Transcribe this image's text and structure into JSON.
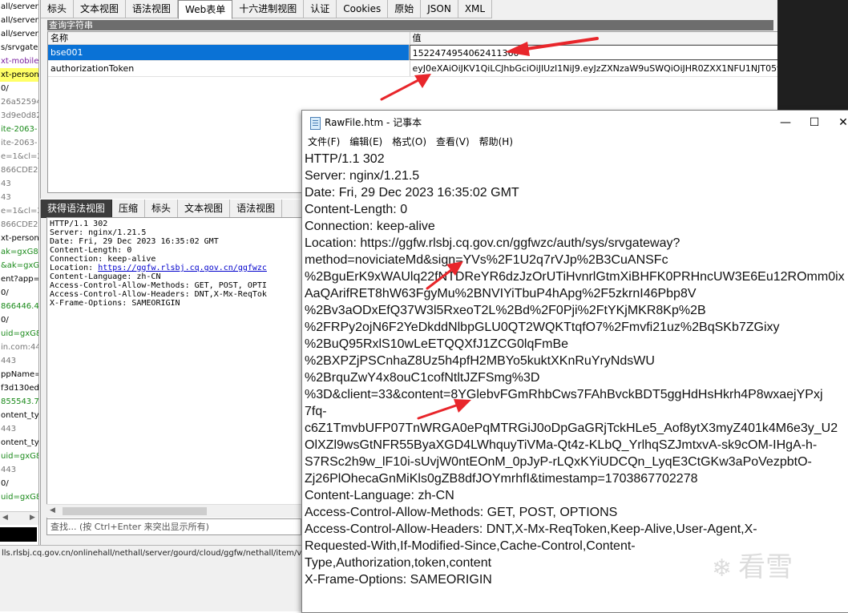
{
  "left_panel": {
    "rows": [
      {
        "text": "all/server/",
        "style": "plain"
      },
      {
        "text": "all/server/",
        "style": "plain"
      },
      {
        "text": "all/server/",
        "style": "plain"
      },
      {
        "text": "s/srvgate",
        "style": "plain"
      },
      {
        "text": "xt-mobile-",
        "style": "purple"
      },
      {
        "text": "xt-person-",
        "style": "yellow"
      },
      {
        "text": "0/",
        "style": "plain"
      },
      {
        "text": "26a52594",
        "style": "gray"
      },
      {
        "text": "3d9e0d82",
        "style": "gray"
      },
      {
        "text": "ite-2063-",
        "style": "green"
      },
      {
        "text": "ite-2063-",
        "style": "gray"
      },
      {
        "text": "e=1&cl=2",
        "style": "gray"
      },
      {
        "text": "866CDE2",
        "style": "gray"
      },
      {
        "text": "43",
        "style": "gray"
      },
      {
        "text": "43",
        "style": "gray"
      },
      {
        "text": "e=1&cl=2",
        "style": "gray"
      },
      {
        "text": "866CDE2",
        "style": "gray"
      },
      {
        "text": "xt-person-",
        "style": "plain"
      },
      {
        "text": "ak=gxG8",
        "style": "green"
      },
      {
        "text": "&ak=gxG",
        "style": "green"
      },
      {
        "text": "ent?app=",
        "style": "plain"
      },
      {
        "text": "0/",
        "style": "plain"
      },
      {
        "text": "866446.4",
        "style": "green"
      },
      {
        "text": "0/",
        "style": "plain"
      },
      {
        "text": "uid=gxG8",
        "style": "green"
      },
      {
        "text": "in.com:44",
        "style": "gray"
      },
      {
        "text": "443",
        "style": "gray"
      },
      {
        "text": "ppName=",
        "style": "plain"
      },
      {
        "text": "f3d130ed",
        "style": "plain"
      },
      {
        "text": "855543.7",
        "style": "green"
      },
      {
        "text": "ontent_typ",
        "style": "plain"
      },
      {
        "text": "443",
        "style": "gray"
      },
      {
        "text": "ontent_typ",
        "style": "plain"
      },
      {
        "text": "uid=gxG8",
        "style": "green"
      },
      {
        "text": "443",
        "style": "gray"
      },
      {
        "text": "0/",
        "style": "plain"
      },
      {
        "text": "uid=gxG8",
        "style": "green"
      }
    ]
  },
  "status_url": "lls.rlsbj.cq.gov.cn/onlinehall/nethall/server/gourd/cloud/ggfw/nethall/item/visit",
  "top_tabs": [
    "标头",
    "文本视图",
    "语法视图",
    "Web表单",
    "十六进制视图",
    "认证",
    "Cookies",
    "原始",
    "JSON",
    "XML"
  ],
  "active_top_tab": "Web表单",
  "query_section": {
    "title": "查询字符串",
    "col_name": "名称",
    "col_value": "值",
    "rows": [
      {
        "name": "bse001",
        "value": "1522474954062411360"
      },
      {
        "name": "authorizationToken",
        "value": "eyJ0eXAiOiJKV1QiLCJhbGciOiJIUzI1NiJ9.eyJzZXNzaW9uSWQiOiJHR0ZXX1NFU1NJT05fSURfMT"
      }
    ]
  },
  "bottom_tabs": [
    "获得语法视图",
    "压缩",
    "标头",
    "文本视图",
    "语法视图"
  ],
  "raw_response": {
    "lines": [
      "HTTP/1.1 302",
      "Server: nginx/1.21.5",
      "Date: Fri, 29 Dec 2023 16:35:02 GMT",
      "Content-Length: 0",
      "Connection: keep-alive"
    ],
    "location_label": "Location: ",
    "location_link": "https://ggfw.rlsbj.cq.gov.cn/ggfwzc",
    "lines_after": [
      "Content-Language: zh-CN",
      "Access-Control-Allow-Methods: GET, POST, OPTI",
      "Access-Control-Allow-Headers: DNT,X-Mx-ReqTok",
      "X-Frame-Options: SAMEORIGIN"
    ]
  },
  "find_placeholder": "查找... (按 Ctrl+Enter 来突出显示所有)",
  "notepad": {
    "title": "RawFile.htm - 记事本",
    "menu": [
      "文件(F)",
      "编辑(E)",
      "格式(O)",
      "查看(V)",
      "帮助(H)"
    ],
    "win_min": "—",
    "win_max": "☐",
    "win_close": "✕",
    "lines": [
      "HTTP/1.1 302",
      "Server: nginx/1.21.5",
      "Date: Fri, 29 Dec 2023 16:35:02 GMT",
      "Content-Length: 0",
      "Connection: keep-alive",
      "Location: https://ggfw.rlsbj.cq.gov.cn/ggfwzc/auth/sys/srvgateway?",
      "method=noviciateMd&sign=YVs%2F1U2q7rVJp%2B3CuANSFc",
      "%2BguErK9xWAUlq22fNTDReYR6dzJzOrUTiHvnrlGtmXiBHFK0PRHncUW3E6Eu12ROmm0ix",
      "AaQArifRET8hW63FgyMu%2BNVIYiTbuP4hApg%2F5zkrnI46Pbp8V",
      "%2Bv3aODxEfQ37W3l5RxeoT2L%2Bd%2F0Pji%2FtYKjMKR8Kp%2B",
      "%2FRPy2ojN6F2YeDkddNlbpGLU0QT2WQKTtqfO7%2Fmvfi21uz%2BqSKb7ZGixy",
      "%2BuQ95RxlS10wLeETQQXfJ1ZCG0lqFmBe",
      "%2BXPZjPSCnhaZ8Uz5h4pfH2MBYo5kuktXKnRuYryNdsWU",
      "%2BrquZwY4x8ouC1cofNtltJZFSmg%3D",
      "%3D&client=33&content=8YGlebvFGmRhbCws7FAhBvckBDT5ggHdHsHkrh4P8wxaejYPxj",
      "7fq-",
      "c6Z1TmvbUFP07TnWRGA0ePqMTRGiJ0oDpGaGRjTckHLe5_Aof8ytX3myZ401k4M6e3y_U2",
      "OlXZl9wsGtNFR55ByaXGD4LWhquyTiVMa-Qt4z-KLbQ_YrlhqSZJmtxvA-sk9cOM-IHgA-h-",
      "S7RSc2h9w_lF10i-sUvjW0ntEOnM_0pJyP-rLQxKYiUDCQn_LyqE3CtGKw3aPoVezpbtO-",
      "Zj26PlOhecaGnMiKls0gZB8dfJOYmrhfI&timestamp=1703867702278",
      "Content-Language: zh-CN",
      "Access-Control-Allow-Methods: GET, POST, OPTIONS",
      "Access-Control-Allow-Headers: DNT,X-Mx-ReqToken,Keep-Alive,User-Agent,X-",
      "Requested-With,If-Modified-Since,Cache-Control,Content-",
      "Type,Authorization,token,content",
      "X-Frame-Options: SAMEORIGIN"
    ]
  },
  "watermark": {
    "icon": "snowflake-icon",
    "text": "看雪"
  },
  "colors": {
    "selection": "#0a72d6",
    "arrow": "#e8262b",
    "link": "#0000cc"
  }
}
